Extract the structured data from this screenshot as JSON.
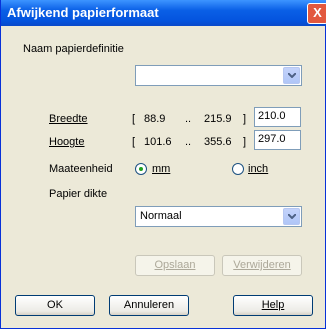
{
  "window": {
    "title": "Afwijkend papierformaat",
    "close_label": "X"
  },
  "paper_name": {
    "label": "Naam papierdefinitie",
    "value": ""
  },
  "width": {
    "label": "Breedte",
    "range_open": "[",
    "min": "88.9",
    "sep": "..",
    "max": "215.9",
    "range_close": "]",
    "value": "210.0"
  },
  "height": {
    "label": "Hoogte",
    "range_open": "[",
    "min": "101.6",
    "sep": "..",
    "max": "355.6",
    "range_close": "]",
    "value": "297.0"
  },
  "unit": {
    "label": "Maateenheid",
    "options": [
      "mm",
      "inch"
    ],
    "selected": "mm"
  },
  "thickness": {
    "label": "Papier dikte",
    "value": "Normaal"
  },
  "actions": {
    "save": "Opslaan",
    "delete": "Verwijderen"
  },
  "footer": {
    "ok": "OK",
    "cancel": "Annuleren",
    "help": "Help"
  }
}
